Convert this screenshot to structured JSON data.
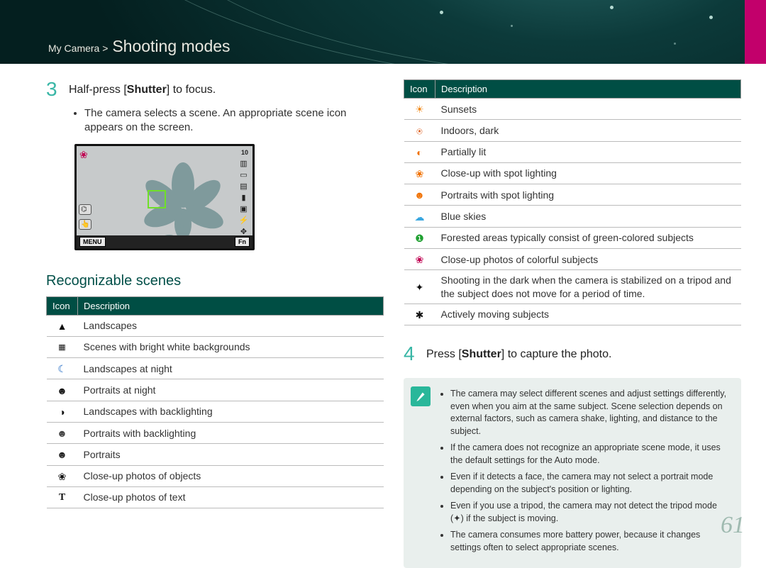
{
  "breadcrumb": {
    "parent": "My Camera >",
    "current": "Shooting modes"
  },
  "step3": {
    "num": "3",
    "text_before": "Half-press [",
    "text_bold": "Shutter",
    "text_after": "] to focus.",
    "bullet": "The camera selects a scene. An appropriate scene icon appears on the screen."
  },
  "screenshot": {
    "menu": "MENU",
    "fn": "Fn",
    "shots": "10",
    "touch": "👆"
  },
  "section_title": "Recognizable scenes",
  "table_headers": {
    "icon": "Icon",
    "desc": "Description"
  },
  "scenes_left": [
    {
      "glyph": "▲",
      "style": "color:#111",
      "desc": "Landscapes"
    },
    {
      "glyph": "▦",
      "style": "color:#111;font-size:11px",
      "desc": "Scenes with bright white backgrounds"
    },
    {
      "glyph": "☾",
      "style": "color:#1060c0",
      "desc": "Landscapes at night"
    },
    {
      "glyph": "☻",
      "style": "color:#111",
      "desc": "Portraits at night"
    },
    {
      "glyph": "◑",
      "style": "color:#111",
      "desc": "Landscapes with backlighting"
    },
    {
      "glyph": "☻",
      "style": "color:#111;opacity:.8",
      "desc": "Portraits with backlighting"
    },
    {
      "glyph": "☻",
      "style": "color:#222",
      "desc": "Portraits"
    },
    {
      "glyph": "❀",
      "style": "color:#111",
      "desc": "Close-up photos of objects"
    },
    {
      "glyph": "T",
      "style": "color:#111;font-family:serif;font-weight:bold",
      "desc": "Close-up photos of text"
    }
  ],
  "scenes_right": [
    {
      "glyph": "☀",
      "style": "color:#f08a1b",
      "desc": "Sunsets"
    },
    {
      "glyph": "⍟",
      "style": "color:#d94a00",
      "desc": "Indoors, dark"
    },
    {
      "glyph": "◐",
      "style": "color:#f07000",
      "desc": "Partially lit"
    },
    {
      "glyph": "❀",
      "style": "color:#f07000",
      "desc": "Close-up with spot lighting"
    },
    {
      "glyph": "☻",
      "style": "color:#f07000",
      "desc": "Portraits with spot lighting"
    },
    {
      "glyph": "☁",
      "style": "color:#3aa7e0",
      "desc": "Blue skies"
    },
    {
      "glyph": "❶",
      "style": "color:#1fa030",
      "desc": "Forested areas typically consist of green-colored subjects"
    },
    {
      "glyph": "❀",
      "style": "color:#c00050",
      "desc": "Close-up photos of colorful subjects"
    },
    {
      "glyph": "✦",
      "style": "color:#111",
      "desc": "Shooting in the dark when the camera is stabilized on a tripod and the subject does not move for a period of time."
    },
    {
      "glyph": "✱",
      "style": "color:#111",
      "desc": "Actively moving subjects"
    }
  ],
  "step4": {
    "num": "4",
    "text_before": "Press [",
    "text_bold": "Shutter",
    "text_after": "] to capture the photo."
  },
  "notes": [
    "The camera may select different scenes and adjust settings differently, even when you aim at the same subject. Scene selection depends on external factors, such as camera shake, lighting, and distance to the subject.",
    "If the camera does not recognize an appropriate scene mode, it uses the default settings for the Auto mode.",
    "Even if it detects a face, the camera may not select a portrait mode depending on the subject's position or lighting.",
    "Even if you use a tripod, the camera may not detect the tripod mode (✦) if the subject is moving.",
    "The camera consumes more battery power, because it changes settings often to select appropriate scenes."
  ],
  "page_number": "61"
}
